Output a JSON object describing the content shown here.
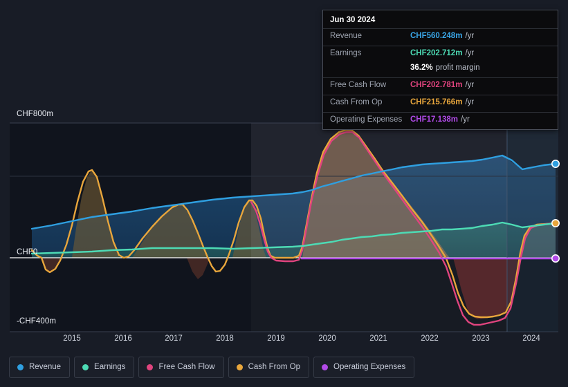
{
  "tooltip": {
    "date": "Jun 30 2024",
    "rows": [
      {
        "key": "Revenue",
        "value": "CHF560.248m",
        "suffix": "/yr",
        "color": "#3aa6e8"
      },
      {
        "key": "Earnings",
        "value": "CHF202.712m",
        "suffix": "/yr",
        "color": "#4ddbb5"
      },
      {
        "key": "",
        "value": "36.2%",
        "suffix": "profit margin",
        "color": "#ffffff",
        "margin": true
      },
      {
        "key": "Free Cash Flow",
        "value": "CHF202.781m",
        "suffix": "/yr",
        "color": "#e0447e"
      },
      {
        "key": "Cash From Op",
        "value": "CHF215.766m",
        "suffix": "/yr",
        "color": "#e8a63c"
      },
      {
        "key": "Operating Expenses",
        "value": "CHF17.138m",
        "suffix": "/yr",
        "color": "#b14ae8"
      }
    ]
  },
  "legend": {
    "items": [
      {
        "label": "Revenue",
        "color": "#2f9fe0"
      },
      {
        "label": "Earnings",
        "color": "#4ddbb5"
      },
      {
        "label": "Free Cash Flow",
        "color": "#e0447e"
      },
      {
        "label": "Cash From Op",
        "color": "#e8a63c"
      },
      {
        "label": "Operating Expenses",
        "color": "#b14ae8"
      }
    ]
  },
  "axis": {
    "y_labels": [
      "CHF800m",
      "CHF0",
      "-CHF400m"
    ],
    "x_labels": [
      "2015",
      "2016",
      "2017",
      "2018",
      "2019",
      "2020",
      "2021",
      "2022",
      "2023",
      "2024"
    ]
  },
  "chart_data": {
    "type": "line",
    "title": "",
    "xlabel": "",
    "ylabel": "CHF",
    "ylim": [
      -400,
      800
    ],
    "yticks": [
      800,
      0,
      -400
    ],
    "ytick_labels": [
      "CHF800m",
      "CHF0",
      "-CHF400m"
    ],
    "grid": true,
    "legend_position": "bottom",
    "currency": "CHF",
    "unit": "m",
    "x": [
      "2015",
      "2016",
      "2017",
      "2018",
      "2019",
      "2020",
      "2021",
      "2022",
      "2023",
      "2024"
    ],
    "forecast_divider_x": "2023.6",
    "series": [
      {
        "name": "Revenue",
        "color": "#2f9fe0",
        "x": [
          2014.65,
          2015,
          2015.5,
          2016,
          2016.5,
          2017,
          2017.5,
          2018,
          2018.5,
          2019,
          2019.5,
          2020,
          2020.5,
          2021,
          2021.5,
          2022,
          2022.5,
          2023,
          2023.5,
          2024,
          2024.5
        ],
        "values": [
          265,
          282,
          297,
          308,
          313,
          321,
          330,
          338,
          348,
          356,
          362,
          368,
          396,
          428,
          452,
          470,
          482,
          487,
          508,
          530,
          560
        ]
      },
      {
        "name": "Earnings",
        "color": "#4ddbb5",
        "x": [
          2014.65,
          2015,
          2015.5,
          2016,
          2016.5,
          2017,
          2017.5,
          2018,
          2018.5,
          2019,
          2019.5,
          2020,
          2020.5,
          2021,
          2021.5,
          2022,
          2022.5,
          2023,
          2023.5,
          2024,
          2024.5
        ],
        "values": [
          23,
          26,
          30,
          33,
          36,
          38,
          38,
          37,
          36,
          34,
          35,
          42,
          56,
          70,
          84,
          98,
          110,
          122,
          152,
          180,
          203
        ]
      },
      {
        "name": "Free Cash Flow",
        "color": "#e0447e",
        "x": [
          2018.35,
          2018.6,
          2018.85,
          2019,
          2019.3,
          2019.6,
          2020,
          2020.5,
          2021,
          2021.5,
          2022,
          2022.3,
          2022.6,
          2023,
          2023.3,
          2023.6,
          2024,
          2024.5
        ],
        "values": [
          300,
          60,
          -12,
          -15,
          -15,
          -12,
          560,
          780,
          610,
          430,
          215,
          10,
          -330,
          -415,
          -400,
          -390,
          175,
          203
        ]
      },
      {
        "name": "Cash From Op",
        "color": "#e8a63c",
        "x": [
          2014.65,
          2014.85,
          2015.1,
          2015.5,
          2015.75,
          2016,
          2016.4,
          2016.9,
          2017.25,
          2017.6,
          2018,
          2018.35,
          2018.6,
          2018.9,
          2019.2,
          2019.6,
          2020,
          2020.5,
          2021,
          2021.5,
          2022,
          2022.3,
          2022.6,
          2023,
          2023.3,
          2023.6,
          2024,
          2024.5
        ],
        "values": [
          55,
          -90,
          -130,
          490,
          430,
          10,
          180,
          265,
          30,
          -135,
          100,
          310,
          120,
          -5,
          -8,
          -5,
          560,
          785,
          615,
          435,
          225,
          30,
          -300,
          -370,
          -360,
          -345,
          190,
          216
        ]
      },
      {
        "name": "Operating Expenses",
        "color": "#b14ae8",
        "x": [
          2019.1,
          2020,
          2021,
          2022,
          2023,
          2024,
          2024.5
        ],
        "values": [
          16,
          16,
          16.5,
          16.8,
          17,
          17.1,
          17.138
        ]
      }
    ]
  }
}
